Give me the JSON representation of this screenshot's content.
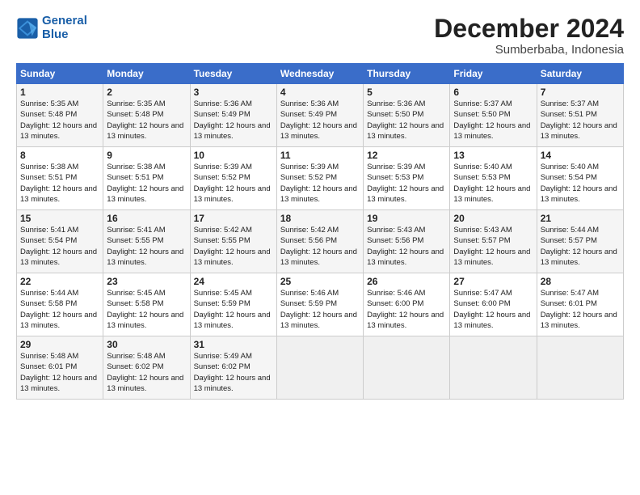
{
  "header": {
    "logo_line1": "General",
    "logo_line2": "Blue",
    "month_title": "December 2024",
    "location": "Sumberbaba, Indonesia"
  },
  "weekdays": [
    "Sunday",
    "Monday",
    "Tuesday",
    "Wednesday",
    "Thursday",
    "Friday",
    "Saturday"
  ],
  "weeks": [
    [
      {
        "day": 1,
        "sunrise": "5:35 AM",
        "sunset": "5:48 PM",
        "daylight": "12 hours and 13 minutes."
      },
      {
        "day": 2,
        "sunrise": "5:35 AM",
        "sunset": "5:48 PM",
        "daylight": "12 hours and 13 minutes."
      },
      {
        "day": 3,
        "sunrise": "5:36 AM",
        "sunset": "5:49 PM",
        "daylight": "12 hours and 13 minutes."
      },
      {
        "day": 4,
        "sunrise": "5:36 AM",
        "sunset": "5:49 PM",
        "daylight": "12 hours and 13 minutes."
      },
      {
        "day": 5,
        "sunrise": "5:36 AM",
        "sunset": "5:50 PM",
        "daylight": "12 hours and 13 minutes."
      },
      {
        "day": 6,
        "sunrise": "5:37 AM",
        "sunset": "5:50 PM",
        "daylight": "12 hours and 13 minutes."
      },
      {
        "day": 7,
        "sunrise": "5:37 AM",
        "sunset": "5:51 PM",
        "daylight": "12 hours and 13 minutes."
      }
    ],
    [
      {
        "day": 8,
        "sunrise": "5:38 AM",
        "sunset": "5:51 PM",
        "daylight": "12 hours and 13 minutes."
      },
      {
        "day": 9,
        "sunrise": "5:38 AM",
        "sunset": "5:51 PM",
        "daylight": "12 hours and 13 minutes."
      },
      {
        "day": 10,
        "sunrise": "5:39 AM",
        "sunset": "5:52 PM",
        "daylight": "12 hours and 13 minutes."
      },
      {
        "day": 11,
        "sunrise": "5:39 AM",
        "sunset": "5:52 PM",
        "daylight": "12 hours and 13 minutes."
      },
      {
        "day": 12,
        "sunrise": "5:39 AM",
        "sunset": "5:53 PM",
        "daylight": "12 hours and 13 minutes."
      },
      {
        "day": 13,
        "sunrise": "5:40 AM",
        "sunset": "5:53 PM",
        "daylight": "12 hours and 13 minutes."
      },
      {
        "day": 14,
        "sunrise": "5:40 AM",
        "sunset": "5:54 PM",
        "daylight": "12 hours and 13 minutes."
      }
    ],
    [
      {
        "day": 15,
        "sunrise": "5:41 AM",
        "sunset": "5:54 PM",
        "daylight": "12 hours and 13 minutes."
      },
      {
        "day": 16,
        "sunrise": "5:41 AM",
        "sunset": "5:55 PM",
        "daylight": "12 hours and 13 minutes."
      },
      {
        "day": 17,
        "sunrise": "5:42 AM",
        "sunset": "5:55 PM",
        "daylight": "12 hours and 13 minutes."
      },
      {
        "day": 18,
        "sunrise": "5:42 AM",
        "sunset": "5:56 PM",
        "daylight": "12 hours and 13 minutes."
      },
      {
        "day": 19,
        "sunrise": "5:43 AM",
        "sunset": "5:56 PM",
        "daylight": "12 hours and 13 minutes."
      },
      {
        "day": 20,
        "sunrise": "5:43 AM",
        "sunset": "5:57 PM",
        "daylight": "12 hours and 13 minutes."
      },
      {
        "day": 21,
        "sunrise": "5:44 AM",
        "sunset": "5:57 PM",
        "daylight": "12 hours and 13 minutes."
      }
    ],
    [
      {
        "day": 22,
        "sunrise": "5:44 AM",
        "sunset": "5:58 PM",
        "daylight": "12 hours and 13 minutes."
      },
      {
        "day": 23,
        "sunrise": "5:45 AM",
        "sunset": "5:58 PM",
        "daylight": "12 hours and 13 minutes."
      },
      {
        "day": 24,
        "sunrise": "5:45 AM",
        "sunset": "5:59 PM",
        "daylight": "12 hours and 13 minutes."
      },
      {
        "day": 25,
        "sunrise": "5:46 AM",
        "sunset": "5:59 PM",
        "daylight": "12 hours and 13 minutes."
      },
      {
        "day": 26,
        "sunrise": "5:46 AM",
        "sunset": "6:00 PM",
        "daylight": "12 hours and 13 minutes."
      },
      {
        "day": 27,
        "sunrise": "5:47 AM",
        "sunset": "6:00 PM",
        "daylight": "12 hours and 13 minutes."
      },
      {
        "day": 28,
        "sunrise": "5:47 AM",
        "sunset": "6:01 PM",
        "daylight": "12 hours and 13 minutes."
      }
    ],
    [
      {
        "day": 29,
        "sunrise": "5:48 AM",
        "sunset": "6:01 PM",
        "daylight": "12 hours and 13 minutes."
      },
      {
        "day": 30,
        "sunrise": "5:48 AM",
        "sunset": "6:02 PM",
        "daylight": "12 hours and 13 minutes."
      },
      {
        "day": 31,
        "sunrise": "5:49 AM",
        "sunset": "6:02 PM",
        "daylight": "12 hours and 13 minutes."
      },
      null,
      null,
      null,
      null
    ]
  ]
}
